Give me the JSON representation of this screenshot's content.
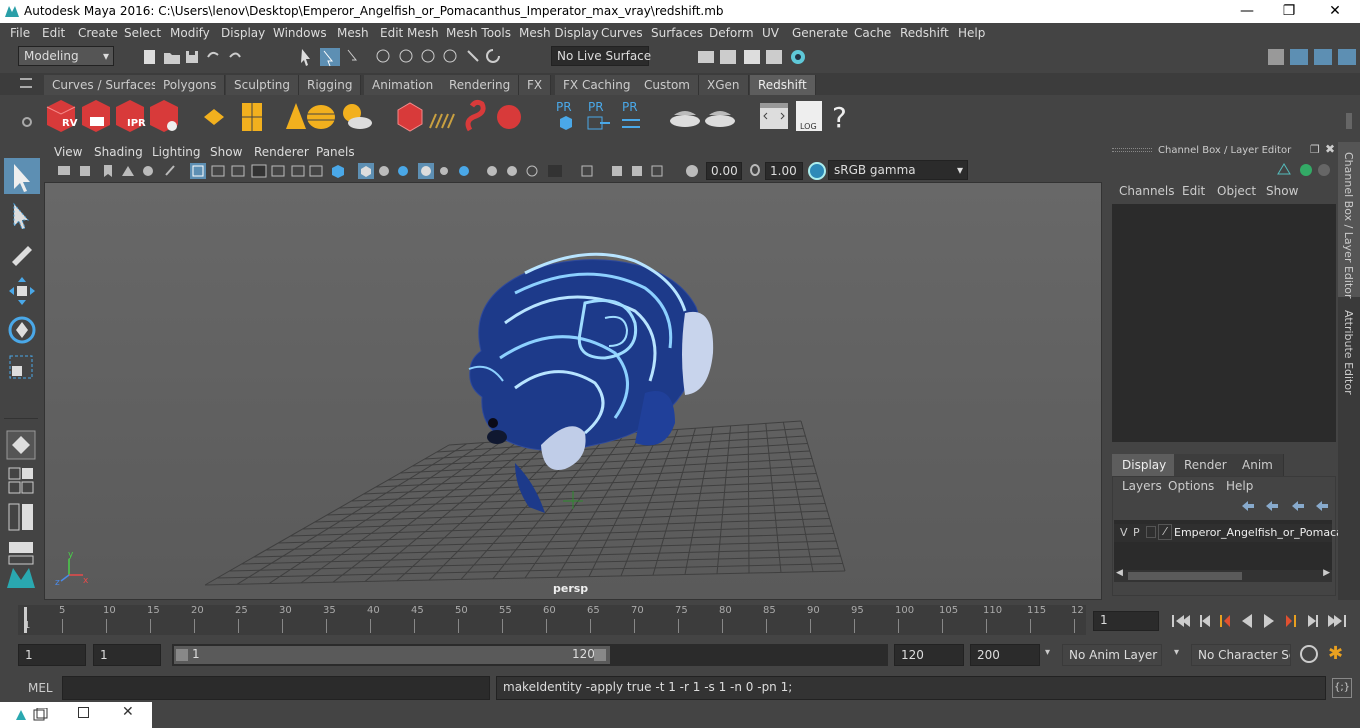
{
  "window": {
    "title": "Autodesk Maya 2016: C:\\Users\\lenov\\Desktop\\Emperor_Angelfish_or_Pomacanthus_Imperator_max_vray\\redshift.mb"
  },
  "menubar": [
    "File",
    "Edit",
    "Create",
    "Select",
    "Modify",
    "Display",
    "Windows",
    "Mesh",
    "Edit Mesh",
    "Mesh Tools",
    "Mesh Display",
    "Curves",
    "Surfaces",
    "Deform",
    "UV",
    "Generate",
    "Cache",
    "Redshift",
    "Help"
  ],
  "statusline": {
    "mode": "Modeling",
    "live_surface": "No Live Surface"
  },
  "shelf_tabs": [
    "Curves / Surfaces",
    "Polygons",
    "Sculpting",
    "Rigging",
    "Animation",
    "Rendering",
    "FX",
    "FX Caching",
    "Custom",
    "XGen",
    "Redshift"
  ],
  "shelf_active": "Redshift",
  "shelf_icon_labels": {
    "rv": "RV",
    "ipr": "IPR",
    "pr": "PR",
    "log": "LOG",
    "help": "?"
  },
  "viewport": {
    "menu": [
      "View",
      "Shading",
      "Lighting",
      "Show",
      "Renderer",
      "Panels"
    ],
    "exposure": "0.00",
    "gamma": "1.00",
    "color_space": "sRGB gamma",
    "camera_label": "persp"
  },
  "channel_box": {
    "title": "Channel Box / Layer Editor",
    "menu": [
      "Channels",
      "Edit",
      "Object",
      "Show"
    ]
  },
  "layer_editor": {
    "tabs": [
      "Display",
      "Render",
      "Anim"
    ],
    "active_tab": "Display",
    "menu": [
      "Layers",
      "Options",
      "Help"
    ],
    "layer": {
      "v": "V",
      "p": "P",
      "name": "Emperor_Angelfish_or_Pomaca"
    }
  },
  "side_tabs": [
    "Channel Box / Layer Editor",
    "Attribute Editor"
  ],
  "timeline": {
    "ticks": [
      "5",
      "10",
      "15",
      "20",
      "25",
      "30",
      "35",
      "40",
      "45",
      "50",
      "55",
      "60",
      "65",
      "70",
      "75",
      "80",
      "85",
      "90",
      "95",
      "100",
      "105",
      "110",
      "115",
      "12"
    ],
    "start_label": "1",
    "current_frame": "1"
  },
  "range": {
    "start": "1",
    "playback_start": "1",
    "slider_start": "1",
    "slider_end": "120",
    "playback_end": "120",
    "end": "200",
    "anim_layer": "No Anim Layer",
    "character_set": "No Character Set"
  },
  "command": {
    "label": "MEL",
    "output": "makeIdentity -apply true -t 1 -r 1 -s 1 -n 0 -pn 1;"
  },
  "colors": {
    "accent": "#5d8fb3",
    "redshift_red": "#e03030",
    "selection_blue": "#4a7fa8"
  }
}
